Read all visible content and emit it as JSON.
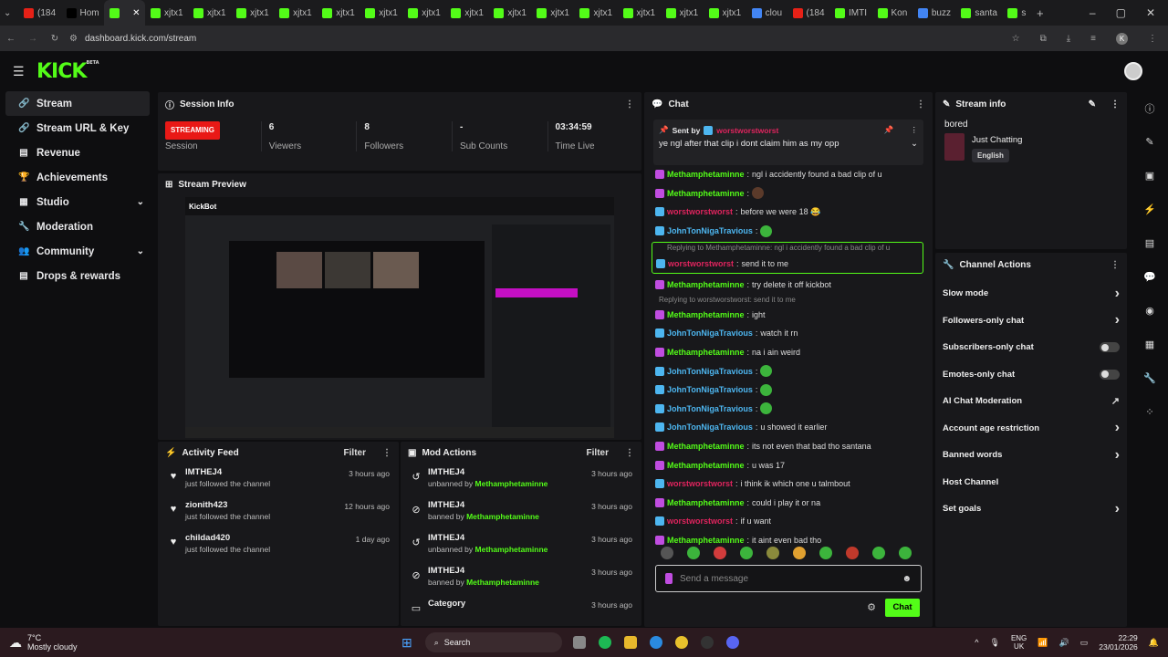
{
  "browser": {
    "tabs": [
      {
        "label": "(184",
        "color": "#e62117"
      },
      {
        "label": "Hom",
        "color": "#000000"
      },
      {
        "label": "",
        "color": "#53fc18",
        "active": true
      },
      {
        "label": "xjtx1",
        "color": "#53fc18"
      },
      {
        "label": "xjtx1",
        "color": "#53fc18"
      },
      {
        "label": "xjtx1",
        "color": "#53fc18"
      },
      {
        "label": "xjtx1",
        "color": "#53fc18"
      },
      {
        "label": "xjtx1",
        "color": "#53fc18"
      },
      {
        "label": "xjtx1",
        "color": "#53fc18"
      },
      {
        "label": "xjtx1",
        "color": "#53fc18"
      },
      {
        "label": "xjtx1",
        "color": "#53fc18"
      },
      {
        "label": "xjtx1",
        "color": "#53fc18"
      },
      {
        "label": "xjtx1",
        "color": "#53fc18"
      },
      {
        "label": "xjtx1",
        "color": "#53fc18"
      },
      {
        "label": "xjtx1",
        "color": "#53fc18"
      },
      {
        "label": "xjtx1",
        "color": "#53fc18"
      },
      {
        "label": "xjtx1",
        "color": "#53fc18"
      },
      {
        "label": "clou",
        "color": "#4285f4"
      },
      {
        "label": "(184",
        "color": "#e62117"
      },
      {
        "label": "IMTI",
        "color": "#53fc18"
      },
      {
        "label": "Kon",
        "color": "#53fc18"
      },
      {
        "label": "buzz",
        "color": "#4285f4"
      },
      {
        "label": "santa",
        "color": "#53fc18"
      },
      {
        "label": "s",
        "color": "#53fc18"
      }
    ],
    "url": "dashboard.kick.com/stream",
    "profile_initial": "K"
  },
  "brand": {
    "logo": "KICK",
    "beta": "BETA",
    "accent": "#53fc18"
  },
  "sidebar": {
    "items": [
      {
        "label": "Stream",
        "icon": "link-icon",
        "active": true
      },
      {
        "label": "Stream URL & Key",
        "icon": "link-icon"
      },
      {
        "label": "Revenue",
        "icon": "chart-icon"
      },
      {
        "label": "Achievements",
        "icon": "trophy-icon"
      },
      {
        "label": "Studio",
        "icon": "studio-icon",
        "chevron": true
      },
      {
        "label": "Moderation",
        "icon": "wrench-icon"
      },
      {
        "label": "Community",
        "icon": "community-icon",
        "chevron": true
      },
      {
        "label": "Drops & rewards",
        "icon": "drops-icon"
      }
    ]
  },
  "session": {
    "title": "Session Info",
    "status_badge": "STREAMING",
    "status_label": "Session",
    "viewers_value": "6",
    "viewers_label": "Viewers",
    "followers_value": "8",
    "followers_label": "Followers",
    "subs_value": "-",
    "subs_label": "Sub Counts",
    "time_value": "03:34:59",
    "time_label": "Time Live"
  },
  "preview": {
    "title": "Stream Preview",
    "inner_brand": "KickBot"
  },
  "activity": {
    "title": "Activity Feed",
    "filter": "Filter",
    "items": [
      {
        "name": "IMTHEJ4",
        "sub": "just followed the channel",
        "time": "3 hours ago"
      },
      {
        "name": "zionith423",
        "sub": "just followed the channel",
        "time": "12 hours ago"
      },
      {
        "name": "childad420",
        "sub": "just followed the channel",
        "time": "1 day ago"
      }
    ]
  },
  "mod": {
    "title": "Mod Actions",
    "filter": "Filter",
    "items": [
      {
        "name": "IMTHEJ4",
        "action": "unbanned by",
        "by": "Methamphetaminne",
        "time": "3 hours ago",
        "icon": "undo-icon"
      },
      {
        "name": "IMTHEJ4",
        "action": "banned by",
        "by": "Methamphetaminne",
        "time": "3 hours ago",
        "icon": "ban-icon"
      },
      {
        "name": "IMTHEJ4",
        "action": "unbanned by",
        "by": "Methamphetaminne",
        "time": "3 hours ago",
        "icon": "undo-icon"
      },
      {
        "name": "IMTHEJ4",
        "action": "banned by",
        "by": "Methamphetaminne",
        "time": "3 hours ago",
        "icon": "ban-icon"
      },
      {
        "name": "Category",
        "action": "",
        "by": "",
        "time": "3 hours ago",
        "icon": "category-icon"
      }
    ]
  },
  "chat": {
    "title": "Chat",
    "pinned_by_label": "Sent by",
    "pinned_by": "worstworstworst",
    "pinned_text": "ye ngl after that clip i dont claim him as my opp",
    "colors": {
      "meth": "#53fc18",
      "john": "#4db6f0",
      "worst": "#e0245e"
    },
    "messages": [
      {
        "user": "Methamphetaminne",
        "c": "meth",
        "badge": "#c04de0",
        "text": "ngl i accidently found a bad clip of u"
      },
      {
        "user": "Methamphetaminne",
        "c": "meth",
        "badge": "#c04de0",
        "text": "",
        "emote": "#5b3a2a"
      },
      {
        "user": "worstworstworst",
        "c": "worst",
        "badge": "#4db6f0",
        "text": "before we were 18 😂"
      },
      {
        "user": "JohnTonNigaTravious",
        "c": "john",
        "badge": "#4db6f0",
        "text": "",
        "emote": "#3cb43c"
      },
      {
        "reply": "Replying to Methamphetaminne: ngl i accidently found a bad clip of u",
        "user": "worstworstworst",
        "c": "worst",
        "badge": "#4db6f0",
        "text": "send it to me",
        "hl": true
      },
      {
        "user": "Methamphetaminne",
        "c": "meth",
        "badge": "#c04de0",
        "text": "try delete it off kickbot"
      },
      {
        "reply": "Replying to worstworstworst: send it to me",
        "user": "Methamphetaminne",
        "c": "meth",
        "badge": "#c04de0",
        "text": "ight"
      },
      {
        "user": "JohnTonNigaTravious",
        "c": "john",
        "badge": "#4db6f0",
        "text": "watch it rn"
      },
      {
        "user": "Methamphetaminne",
        "c": "meth",
        "badge": "#c04de0",
        "text": "na i ain weird"
      },
      {
        "user": "JohnTonNigaTravious",
        "c": "john",
        "badge": "#4db6f0",
        "text": "",
        "emote": "#3cb43c"
      },
      {
        "user": "JohnTonNigaTravious",
        "c": "john",
        "badge": "#4db6f0",
        "text": "",
        "emote": "#3cb43c"
      },
      {
        "user": "JohnTonNigaTravious",
        "c": "john",
        "badge": "#4db6f0",
        "text": "",
        "emote": "#3cb43c"
      },
      {
        "user": "JohnTonNigaTravious",
        "c": "john",
        "badge": "#4db6f0",
        "text": "u showed it earlier"
      },
      {
        "user": "Methamphetaminne",
        "c": "meth",
        "badge": "#c04de0",
        "text": "its not even that bad tho santana"
      },
      {
        "user": "Methamphetaminne",
        "c": "meth",
        "badge": "#c04de0",
        "text": "u was 17"
      },
      {
        "user": "worstworstworst",
        "c": "worst",
        "badge": "#4db6f0",
        "text": "i think ik which one u talmbout"
      },
      {
        "user": "Methamphetaminne",
        "c": "meth",
        "badge": "#c04de0",
        "text": "could i play it or na"
      },
      {
        "user": "worstworstworst",
        "c": "worst",
        "badge": "#4db6f0",
        "text": "if u want"
      },
      {
        "user": "Methamphetaminne",
        "c": "meth",
        "badge": "#c04de0",
        "text": "it aint even bad tho"
      }
    ],
    "emote_colors": [
      "#555",
      "#3cb43c",
      "#d23c3c",
      "#3cb43c",
      "#8a8a3c",
      "#e0a030",
      "#3cb43c",
      "#c0392b",
      "#3cb43c",
      "#3cb43c"
    ],
    "input_placeholder": "Send a message",
    "send_label": "Chat"
  },
  "stream_info": {
    "title": "Stream info",
    "stream_title": "bored",
    "category": "Just Chatting",
    "language": "English"
  },
  "channel_actions": {
    "title": "Channel Actions",
    "items": [
      {
        "label": "Slow mode",
        "type": "chevron"
      },
      {
        "label": "Followers-only chat",
        "type": "chevron"
      },
      {
        "label": "Subscribers-only chat",
        "type": "toggle"
      },
      {
        "label": "Emotes-only chat",
        "type": "toggle"
      },
      {
        "label": "AI Chat Moderation",
        "type": "external"
      },
      {
        "label": "Account age restriction",
        "type": "chevron"
      },
      {
        "label": "Banned words",
        "type": "chevron"
      },
      {
        "label": "Host Channel",
        "type": "none"
      },
      {
        "label": "Set goals",
        "type": "chevron"
      }
    ]
  },
  "rail": {
    "icons": [
      "info-icon",
      "pencil-icon",
      "clip-icon",
      "bolt-icon",
      "poll-icon",
      "chat-bubble-icon",
      "broadcast-icon",
      "layout-icon",
      "wrench-icon",
      "dots-icon"
    ]
  },
  "taskbar": {
    "weather_temp": "7°C",
    "weather_desc": "Mostly cloudy",
    "search": "Search",
    "lang": "ENG",
    "region": "UK",
    "time": "22:29",
    "date": "23/01/2026"
  }
}
